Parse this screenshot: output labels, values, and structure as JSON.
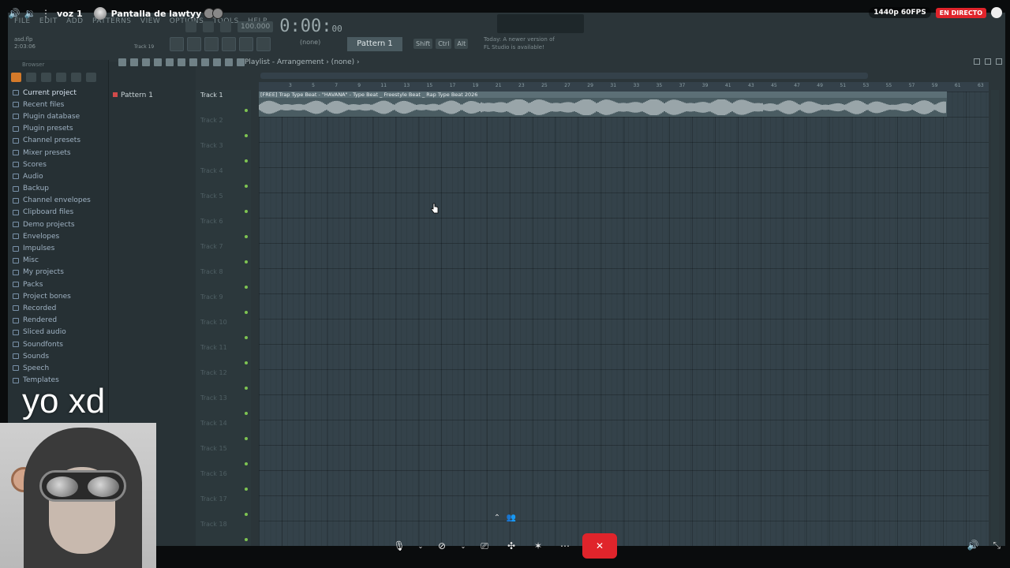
{
  "stream": {
    "channel": "voz 1",
    "title": "Pantalla de lawtyy",
    "quality": "1440p 60FPS",
    "live_label": "EN DIRECTO"
  },
  "fl": {
    "menu": [
      "FILE",
      "EDIT",
      "ADD",
      "PATTERNS",
      "VIEW",
      "OPTIONS",
      "TOOLS",
      "HELP"
    ],
    "hint_line1": "asd.flp",
    "hint_line2": "2:03:06",
    "track_indicator": "Track 19",
    "tempo": "100.000",
    "clock_main": "0:00:",
    "clock_small": "00",
    "none_label": "(none)",
    "pattern": "Pattern 1",
    "mod_keys": [
      "Shift",
      "Ctrl",
      "Alt"
    ],
    "news_line1": "Today: A newer version of",
    "news_line2": "FL Studio is available!",
    "browser_head": "Browser",
    "browser_items": [
      "Current project",
      "Recent files",
      "Plugin database",
      "Plugin presets",
      "Channel presets",
      "Mixer presets",
      "Scores",
      "Audio",
      "Backup",
      "Channel envelopes",
      "Clipboard files",
      "Demo projects",
      "Envelopes",
      "Impulses",
      "Misc",
      "My projects",
      "Packs",
      "Project bones",
      "Recorded",
      "Rendered",
      "Sliced audio",
      "Soundfonts",
      "Sounds",
      "Speech",
      "Templates"
    ],
    "rack_pattern": "Pattern 1",
    "playlist_title": "Playlist - Arrangement › (none) ›",
    "ruler": [
      "3",
      "5",
      "7",
      "9",
      "11",
      "13",
      "15",
      "17",
      "19",
      "21",
      "23",
      "25",
      "27",
      "29",
      "31",
      "33",
      "35",
      "37",
      "39",
      "41",
      "43",
      "45",
      "47",
      "49",
      "51",
      "53",
      "55",
      "57",
      "59",
      "61",
      "63"
    ],
    "tracks": [
      "Track 1",
      "Track 2",
      "Track 3",
      "Track 4",
      "Track 5",
      "Track 6",
      "Track 7",
      "Track 8",
      "Track 9",
      "Track 10",
      "Track 11",
      "Track 12",
      "Track 13",
      "Track 14",
      "Track 15",
      "Track 16",
      "Track 17",
      "Track 18"
    ],
    "clip_name": "[FREE] Trap Type Beat - \"HAVANA\" - Type Beat _ Freestyle Beat _ Rap Type Beat 2026"
  },
  "overlay": {
    "caption": "yo xd"
  },
  "colors": {
    "live": "#e0242b",
    "leave": "#e0242b",
    "track_dot": "#7ec452",
    "accent_orange": "#d47a2a"
  },
  "icons": {
    "controls": [
      "microphone-icon",
      "chevron-down-icon",
      "camera-off-icon",
      "chevron-down-icon",
      "screen-share-icon",
      "activities-icon",
      "soundboard-icon",
      "more-icon",
      "leave-call-icon"
    ]
  }
}
